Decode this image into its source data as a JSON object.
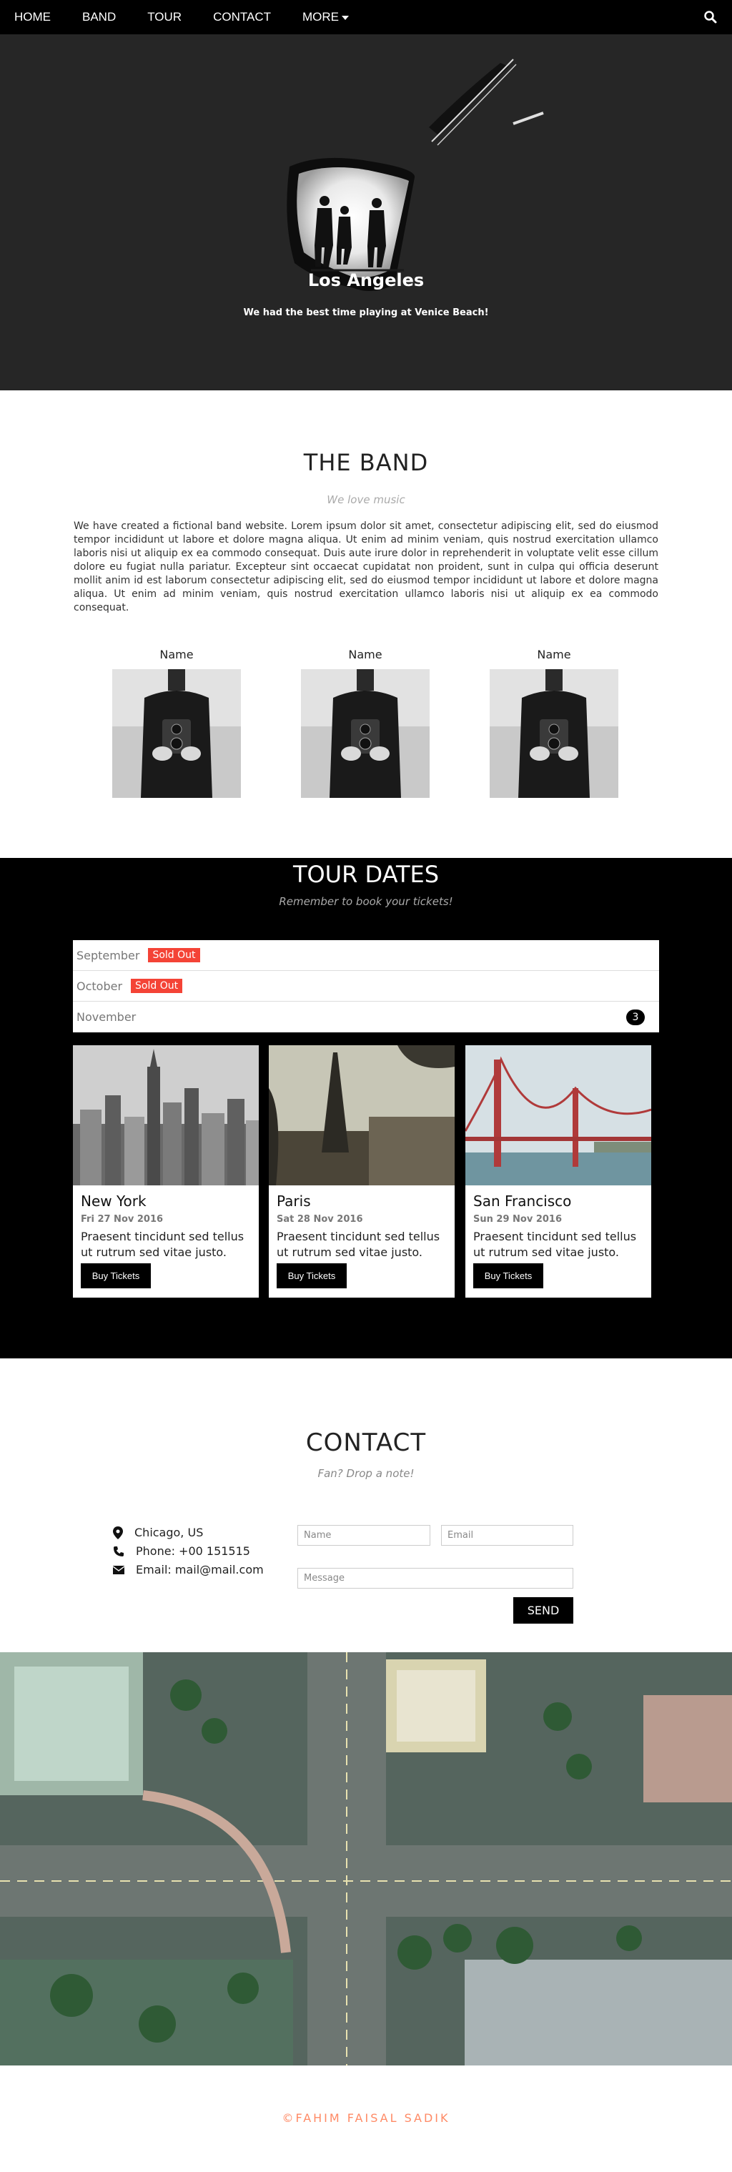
{
  "nav": {
    "items": [
      "HOME",
      "BAND",
      "TOUR",
      "CONTACT",
      "MORE"
    ],
    "search_icon": "search-icon"
  },
  "hero": {
    "title": "Los Angeles",
    "subtitle": "We had the best time playing at Venice Beach!"
  },
  "band": {
    "title": "THE BAND",
    "tagline": "We love music",
    "description": "We have created a fictional band website. Lorem ipsum dolor sit amet, consectetur adipiscing elit, sed do eiusmod tempor incididunt ut labore et dolore magna aliqua. Ut enim ad minim veniam, quis nostrud exercitation ullamco laboris nisi ut aliquip ex ea commodo consequat. Duis aute irure dolor in reprehenderit in voluptate velit esse cillum dolore eu fugiat nulla pariatur. Excepteur sint occaecat cupidatat non proident, sunt in culpa qui officia deserunt mollit anim id est laborum consectetur adipiscing elit, sed do eiusmod tempor incididunt ut labore et dolore magna aliqua. Ut enim ad minim veniam, quis nostrud exercitation ullamco laboris nisi ut aliquip ex ea commodo consequat.",
    "members": [
      {
        "name": "Name"
      },
      {
        "name": "Name"
      },
      {
        "name": "Name"
      }
    ]
  },
  "tour": {
    "title": "TOUR DATES",
    "tagline": "Remember to book your tickets!",
    "months": [
      {
        "label": "September",
        "badge": "Sold Out"
      },
      {
        "label": "October",
        "badge": "Sold Out"
      },
      {
        "label": "November",
        "count": "3"
      }
    ],
    "cards": [
      {
        "city": "New York",
        "date": "Fri 27 Nov 2016",
        "text": "Praesent tincidunt sed tellus ut rutrum sed vitae justo.",
        "button": "Buy Tickets"
      },
      {
        "city": "Paris",
        "date": "Sat 28 Nov 2016",
        "text": "Praesent tincidunt sed tellus ut rutrum sed vitae justo.",
        "button": "Buy Tickets"
      },
      {
        "city": "San Francisco",
        "date": "Sun 29 Nov 2016",
        "text": "Praesent tincidunt sed tellus ut rutrum sed vitae justo.",
        "button": "Buy Tickets"
      }
    ]
  },
  "contact": {
    "title": "CONTACT",
    "tagline": "Fan? Drop a note!",
    "location": "Chicago, US",
    "phone": "Phone: +00 151515",
    "email": "Email: mail@mail.com",
    "name_placeholder": "Name",
    "email_placeholder": "Email",
    "message_placeholder": "Message",
    "send_label": "SEND"
  },
  "footer": {
    "credit": "©FAHIM FAISAL SADIK"
  },
  "colors": {
    "nav_bg": "#000000",
    "sold_out": "#f44336",
    "footer_text": "#ff8a65"
  }
}
